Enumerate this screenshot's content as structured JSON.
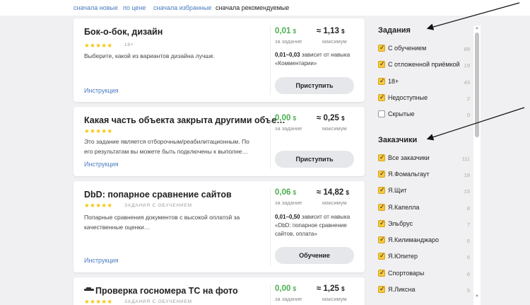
{
  "sort": {
    "items": [
      "сначала новые",
      "по цене",
      "сначала избранные",
      "сначала рекомендуемые"
    ],
    "active_index": 3
  },
  "tasks": [
    {
      "title": "Бок-о-бок, дизайн",
      "stars": "★★★★★",
      "badge": "18+",
      "description": "Выберите, какой из вариантов дизайна лучше.",
      "link": "Инструкция",
      "price": "0,01",
      "price_label": "за задание",
      "max": "≈ 1,13",
      "max_label": "максимум",
      "currency": "$",
      "dependence_range": "0,01–0,03",
      "dependence_text": " зависит от навыка «Комментарии»",
      "button": "Приступить"
    },
    {
      "title": "Какая часть объекта закрыта другими объе…",
      "stars": "★★★★★",
      "badge": "",
      "description": "Это задание является отборочным/реабилитационным. По его результатам вы можете быть подключены к выполне…",
      "link": "Инструкция",
      "price": "0,00",
      "price_label": "за задание",
      "max": "≈ 0,25",
      "max_label": "максимум",
      "currency": "$",
      "dependence_range": "",
      "dependence_text": "",
      "button": "Приступить"
    },
    {
      "title": "DbD: попарное сравнение сайтов",
      "stars": "★★★★★",
      "badge": "ЗАДАНИЯ С ОБУЧЕНИЕМ",
      "description": "Попарные сравнения документов с высокой оплатой за качественные оценки…",
      "link": "Инструкция",
      "price": "0,06",
      "price_label": "за задание",
      "max": "≈ 14,82",
      "max_label": "максимум",
      "currency": "$",
      "dependence_range": "0,01–0,50",
      "dependence_text": " зависит от навыка «DbD: попарное сравнение сайтов, оплата»",
      "button": "Обучение"
    },
    {
      "title": "Проверка госномера ТС на фото",
      "stars": "★★★★★",
      "badge": "ЗАДАНИЯ С ОБУЧЕНИЕМ",
      "description": "",
      "link": "",
      "price": "0,00",
      "price_label": "за задание",
      "max": "≈ 1,25",
      "max_label": "максимум",
      "currency": "$",
      "dependence_range": "",
      "dependence_text": "",
      "button": ""
    }
  ],
  "sidebar": {
    "tasks_title": "Задания",
    "task_filters": [
      {
        "label": "С обучением",
        "count": "89",
        "checked": true
      },
      {
        "label": "С отложенной приёмкой",
        "count": "19",
        "checked": true
      },
      {
        "label": "18+",
        "count": "43",
        "checked": true
      },
      {
        "label": "Недоступные",
        "count": "2",
        "checked": true
      },
      {
        "label": "Скрытые",
        "count": "0",
        "checked": false
      }
    ],
    "customers_title": "Заказчики",
    "customer_filters": [
      {
        "label": "Все заказчики",
        "count": "111",
        "checked": true
      },
      {
        "label": "Я.Фомальгаут",
        "count": "18",
        "checked": true
      },
      {
        "label": "Я.Щит",
        "count": "15",
        "checked": true
      },
      {
        "label": "Я.Капелла",
        "count": "8",
        "checked": true
      },
      {
        "label": "Эльбрус",
        "count": "7",
        "checked": true
      },
      {
        "label": "Я.Килиманджаро",
        "count": "6",
        "checked": true
      },
      {
        "label": "Я.Юпитер",
        "count": "6",
        "checked": true
      },
      {
        "label": "Спортовары",
        "count": "6",
        "checked": true
      },
      {
        "label": "Я.Ликсна",
        "count": "5",
        "checked": true
      }
    ]
  },
  "colors": {
    "accent_link": "#4a7bc0",
    "price_green": "#4caf50",
    "star": "#f5c400",
    "checkbox": "#f7c840"
  }
}
